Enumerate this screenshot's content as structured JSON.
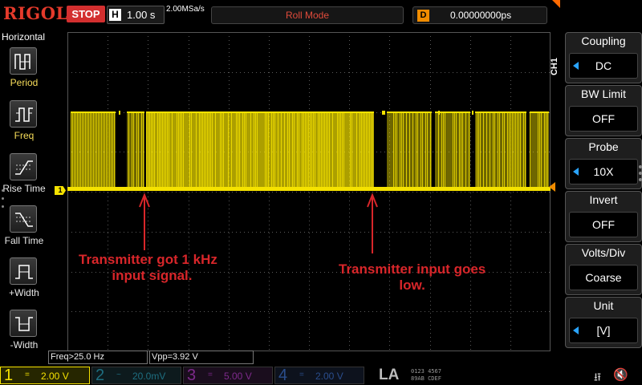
{
  "topbar": {
    "logo": "RIGOL",
    "run_state": "STOP",
    "timebase_label": "H",
    "timebase_value": "1.00 s",
    "sample_rate": "2.00MSa/s",
    "trigger_mode": "Roll Mode",
    "delay_label": "D",
    "delay_value": "0.00000000ps"
  },
  "left_menu": {
    "title": "Horizontal",
    "items": [
      {
        "label": "Period",
        "icon": "period-icon"
      },
      {
        "label": "Freq",
        "icon": "freq-icon"
      },
      {
        "label": "Rise Time",
        "icon": "rise-time-icon"
      },
      {
        "label": "Fall Time",
        "icon": "fall-time-icon"
      },
      {
        "label": "+Width",
        "icon": "positive-width-icon"
      },
      {
        "label": "-Width",
        "icon": "negative-width-icon"
      }
    ]
  },
  "waveform": {
    "channel_marker": "1",
    "trace_color": "#f5e200",
    "annotation_color": "#d8262a",
    "annotations": [
      {
        "line1": "Transmitter got 1 kHz",
        "line2": "input signal."
      },
      {
        "line1": "Transmitter input goes",
        "line2": "low."
      }
    ]
  },
  "measurements": {
    "freq": "Freq>25.0 Hz",
    "vpp": "Vpp=3.92 V"
  },
  "right_menu": {
    "channel_tab": "CH1",
    "items": [
      {
        "title": "Coupling",
        "value": "DC",
        "has_arrow": true
      },
      {
        "title": "BW Limit",
        "value": "OFF",
        "has_arrow": false
      },
      {
        "title": "Probe",
        "value": "10X",
        "has_arrow": true
      },
      {
        "title": "Invert",
        "value": "OFF",
        "has_arrow": false
      },
      {
        "title": "Volts/Div",
        "value": "Coarse",
        "has_arrow": false
      },
      {
        "title": "Unit",
        "value": "[V]",
        "has_arrow": true
      }
    ]
  },
  "bottombar": {
    "channels": [
      {
        "num": "1",
        "coupling": "=",
        "scale": "2.00 V",
        "color": "#f5e200"
      },
      {
        "num": "2",
        "coupling": "~",
        "scale": "20.0mV",
        "color": "#2ad4ff"
      },
      {
        "num": "3",
        "coupling": "=",
        "scale": "5.00 V",
        "color": "#e040fb"
      },
      {
        "num": "4",
        "coupling": "=",
        "scale": "2.00 V",
        "color": "#3a7cff"
      }
    ],
    "la_label": "LA",
    "la_row1": "0123 4567",
    "la_row2": "89AB CDEF"
  }
}
